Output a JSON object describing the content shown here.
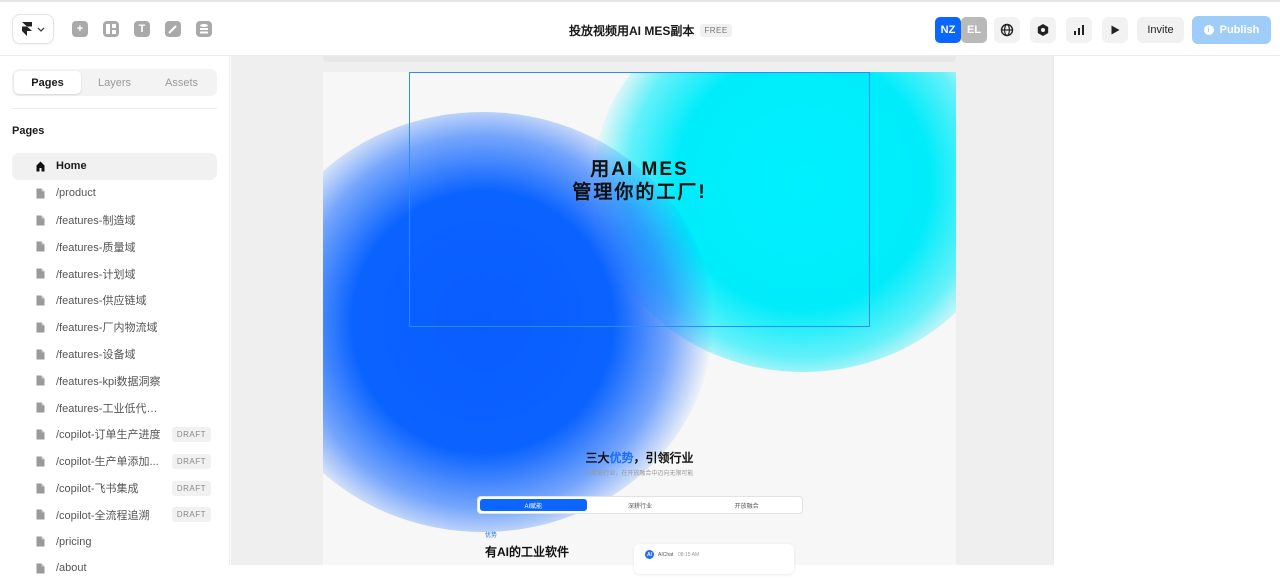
{
  "topbar": {
    "title": "投放视频用AI MES副本",
    "plan_badge": "FREE",
    "avatars": [
      {
        "initials": "NZ",
        "color": "#0a66ff"
      },
      {
        "initials": "EL",
        "color": "#b9b9b9"
      }
    ],
    "tool_icons": [
      "insert-icon",
      "layout-icon",
      "text-icon",
      "vector-icon",
      "cms-icon"
    ],
    "right_icons": [
      "globe-icon",
      "settings-hexagon-icon",
      "analytics-icon",
      "play-icon"
    ],
    "invite_label": "Invite",
    "publish_label": "Publish",
    "accent_color": "#9fcdf9"
  },
  "sidebar": {
    "tabs": [
      {
        "label": "Pages",
        "active": true
      },
      {
        "label": "Layers",
        "active": false
      },
      {
        "label": "Assets",
        "active": false
      }
    ],
    "section_heading": "Pages",
    "pages": [
      {
        "label": "Home",
        "icon": "home-icon",
        "active": true,
        "draft": ""
      },
      {
        "label": "/product",
        "icon": "page-icon",
        "active": false,
        "draft": ""
      },
      {
        "label": "/features-制造域",
        "icon": "page-icon",
        "active": false,
        "draft": ""
      },
      {
        "label": "/features-质量域",
        "icon": "page-icon",
        "active": false,
        "draft": ""
      },
      {
        "label": "/features-计划域",
        "icon": "page-icon",
        "active": false,
        "draft": ""
      },
      {
        "label": "/features-供应链域",
        "icon": "page-icon",
        "active": false,
        "draft": ""
      },
      {
        "label": "/features-厂内物流域",
        "icon": "page-icon",
        "active": false,
        "draft": ""
      },
      {
        "label": "/features-设备域",
        "icon": "page-icon",
        "active": false,
        "draft": ""
      },
      {
        "label": "/features-kpi数据洞察",
        "icon": "page-icon",
        "active": false,
        "draft": ""
      },
      {
        "label": "/features-工业低代码平台",
        "icon": "page-icon",
        "active": false,
        "draft": ""
      },
      {
        "label": "/copilot-订单生产进度",
        "icon": "page-icon",
        "active": false,
        "draft": "DRAFT"
      },
      {
        "label": "/copilot-生产单添加...",
        "icon": "page-icon",
        "active": false,
        "draft": "DRAFT"
      },
      {
        "label": "/copilot-飞书集成",
        "icon": "page-icon",
        "active": false,
        "draft": "DRAFT"
      },
      {
        "label": "/copilot-全流程追溯",
        "icon": "page-icon",
        "active": false,
        "draft": "DRAFT"
      },
      {
        "label": "/pricing",
        "icon": "page-icon",
        "active": false,
        "draft": ""
      },
      {
        "label": "/about",
        "icon": "page-icon",
        "active": false,
        "draft": ""
      }
    ]
  },
  "canvas": {
    "hero_line1": "用AI MES",
    "hero_line2": "管理你的工厂!",
    "section_title_pre": "三大",
    "section_title_highlight": "优势",
    "section_title_post": "，引领行业",
    "section_subtitle": "AI赋能行业，在开放融合中迈向无限可能",
    "segments": [
      {
        "label": "AI赋能",
        "active": true
      },
      {
        "label": "深耕行业",
        "active": false
      },
      {
        "label": "开放融合",
        "active": false
      }
    ],
    "feature_tag": "优势",
    "feature_title": "有AI的工业软件",
    "chat_badge": "AI",
    "chat_name": "AIChat",
    "chat_time": "08:15 AM",
    "colors": {
      "blue": "#0a5cff",
      "cyan": "#00f0ff",
      "selection": "#2a8cff"
    }
  }
}
